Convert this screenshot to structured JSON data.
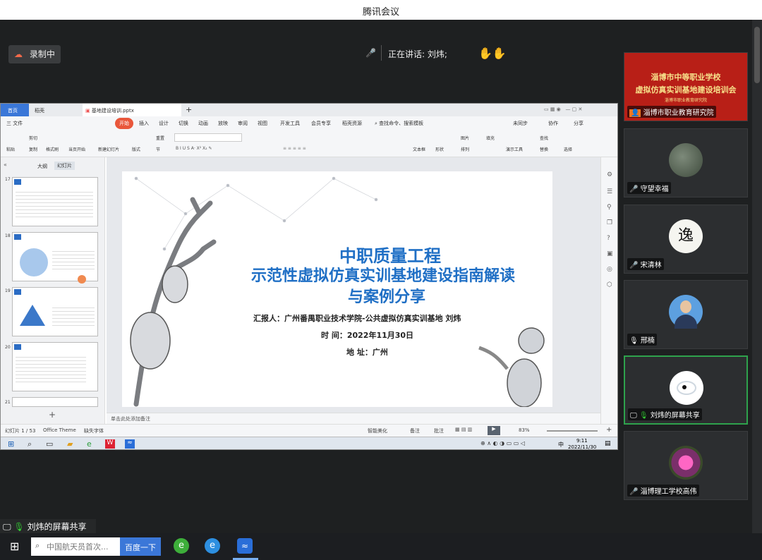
{
  "window": {
    "title": "腾讯会议"
  },
  "meeting": {
    "recording_label": "录制中",
    "speaking_label": "正在讲话: 刘炜;"
  },
  "shared_screen": {
    "wps_tabs": [
      "首页",
      "稻壳",
      "基地建设培训.pptx"
    ],
    "menu": [
      "三 文件",
      "开始",
      "插入",
      "设计",
      "切换",
      "动画",
      "放映",
      "审阅",
      "视图",
      "开发工具",
      "会员专享",
      "稻壳资源",
      "查找命令、搜索模板"
    ],
    "menu_right": [
      "未同步",
      "协作",
      "分享"
    ],
    "ribbon_buttons": [
      "粘贴",
      "剪切",
      "复制",
      "格式刷",
      "当页开始",
      "新建幻灯片",
      "版式",
      "节",
      "重置",
      "文本框",
      "形状",
      "排列",
      "图片",
      "填充",
      "演示工具",
      "查找",
      "替换",
      "选择"
    ],
    "panel_tabs": [
      "大纲",
      "幻灯片"
    ],
    "slide_numbers": [
      "17",
      "18",
      "19",
      "20",
      "21"
    ],
    "slide": {
      "title_line1": "中职质量工程",
      "title_line2": "示范性虚拟仿真实训基地建设指南解读",
      "title_line3": "与案例分享",
      "reporter": "汇报人：广州番禺职业技术学院-公共虚拟仿真实训基地 刘炜",
      "time": "时    间：2022年11月30日",
      "place": "地    址：广州"
    },
    "notes_placeholder": "单击此处添加备注",
    "status_left": [
      "幻灯片 1 / 53",
      "Office Theme",
      "缺失字体"
    ],
    "status_right": [
      "智能美化",
      "备注",
      "批注",
      "83%"
    ],
    "clock_time": "9:11",
    "clock_date": "2022/11/30",
    "ime": "中"
  },
  "participants": [
    {
      "name": "淄博市职业教育研究院",
      "banner_line1": "淄博市中等职业学校",
      "banner_line2": "虚拟仿真实训基地建设培训会",
      "banner_line3": "淄博市职业教育研究院"
    },
    {
      "name": "守望幸福"
    },
    {
      "name": "宋清林"
    },
    {
      "name": "邢楠"
    },
    {
      "name": "刘炜的屏幕共享"
    },
    {
      "name": "淄博理工学校高伟"
    }
  ],
  "share_label": "刘炜的屏幕共享",
  "taskbar": {
    "search_placeholder": "中国航天员首次...",
    "search_button": "百度一下"
  }
}
